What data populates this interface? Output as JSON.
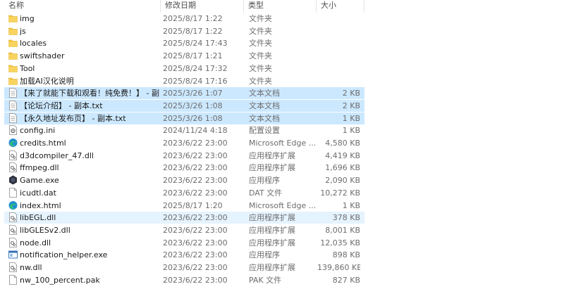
{
  "columns": {
    "name": "名称",
    "date": "修改日期",
    "type": "类型",
    "size": "大小"
  },
  "colors": {
    "folder": "#f4c542",
    "selected_bg": "#cce8ff",
    "hover_bg": "#e5f3ff"
  },
  "files": [
    {
      "name": "img",
      "date": "2025/8/17 1:22",
      "type": "文件夹",
      "size": "",
      "icon": "folder-icon"
    },
    {
      "name": "js",
      "date": "2025/8/17 1:22",
      "type": "文件夹",
      "size": "",
      "icon": "folder-icon"
    },
    {
      "name": "locales",
      "date": "2025/8/24 17:43",
      "type": "文件夹",
      "size": "",
      "icon": "folder-icon"
    },
    {
      "name": "swiftshader",
      "date": "2025/8/17 1:21",
      "type": "文件夹",
      "size": "",
      "icon": "folder-icon"
    },
    {
      "name": "Tool",
      "date": "2025/8/24 17:32",
      "type": "文件夹",
      "size": "",
      "icon": "folder-icon"
    },
    {
      "name": "加载AI汉化说明",
      "date": "2025/8/24 17:16",
      "type": "文件夹",
      "size": "",
      "icon": "folder-icon"
    },
    {
      "name": "【来了就能下载和观看！纯免费！】 - 副...",
      "date": "2025/3/26 1:07",
      "type": "文本文档",
      "size": "2 KB",
      "icon": "text-file-icon",
      "state": "selected"
    },
    {
      "name": "【论坛介绍】 - 副本.txt",
      "date": "2025/3/26 1:08",
      "type": "文本文档",
      "size": "2 KB",
      "icon": "text-file-icon",
      "state": "selected"
    },
    {
      "name": "【永久地址发布页】 - 副本.txt",
      "date": "2025/3/26 1:08",
      "type": "文本文档",
      "size": "1 KB",
      "icon": "text-file-icon",
      "state": "selected"
    },
    {
      "name": "config.ini",
      "date": "2024/11/24 4:18",
      "type": "配置设置",
      "size": "1 KB",
      "icon": "config-file-icon"
    },
    {
      "name": "credits.html",
      "date": "2023/6/22 23:00",
      "type": "Microsoft Edge ...",
      "size": "4,580 KB",
      "icon": "edge-icon"
    },
    {
      "name": "d3dcompiler_47.dll",
      "date": "2023/6/22 23:00",
      "type": "应用程序扩展",
      "size": "4,419 KB",
      "icon": "dll-icon"
    },
    {
      "name": "ffmpeg.dll",
      "date": "2023/6/22 23:00",
      "type": "应用程序扩展",
      "size": "1,696 KB",
      "icon": "dll-icon"
    },
    {
      "name": "Game.exe",
      "date": "2023/6/22 23:00",
      "type": "应用程序",
      "size": "2,090 KB",
      "icon": "exe-icon"
    },
    {
      "name": "icudtl.dat",
      "date": "2023/6/22 23:00",
      "type": "DAT 文件",
      "size": "10,272 KB",
      "icon": "blank-file-icon"
    },
    {
      "name": "index.html",
      "date": "2025/8/17 1:20",
      "type": "Microsoft Edge ...",
      "size": "1 KB",
      "icon": "edge-icon"
    },
    {
      "name": "libEGL.dll",
      "date": "2023/6/22 23:00",
      "type": "应用程序扩展",
      "size": "378 KB",
      "icon": "dll-icon",
      "state": "hover"
    },
    {
      "name": "libGLESv2.dll",
      "date": "2023/6/22 23:00",
      "type": "应用程序扩展",
      "size": "8,001 KB",
      "icon": "dll-icon"
    },
    {
      "name": "node.dll",
      "date": "2023/6/22 23:00",
      "type": "应用程序扩展",
      "size": "12,035 KB",
      "icon": "dll-icon"
    },
    {
      "name": "notification_helper.exe",
      "date": "2023/6/22 23:00",
      "type": "应用程序",
      "size": "898 KB",
      "icon": "app-window-icon"
    },
    {
      "name": "nw.dll",
      "date": "2023/6/22 23:00",
      "type": "应用程序扩展",
      "size": "139,860 KB",
      "icon": "dll-icon"
    },
    {
      "name": "nw_100_percent.pak",
      "date": "2023/6/22 23:00",
      "type": "PAK 文件",
      "size": "827 KB",
      "icon": "blank-file-icon"
    }
  ]
}
